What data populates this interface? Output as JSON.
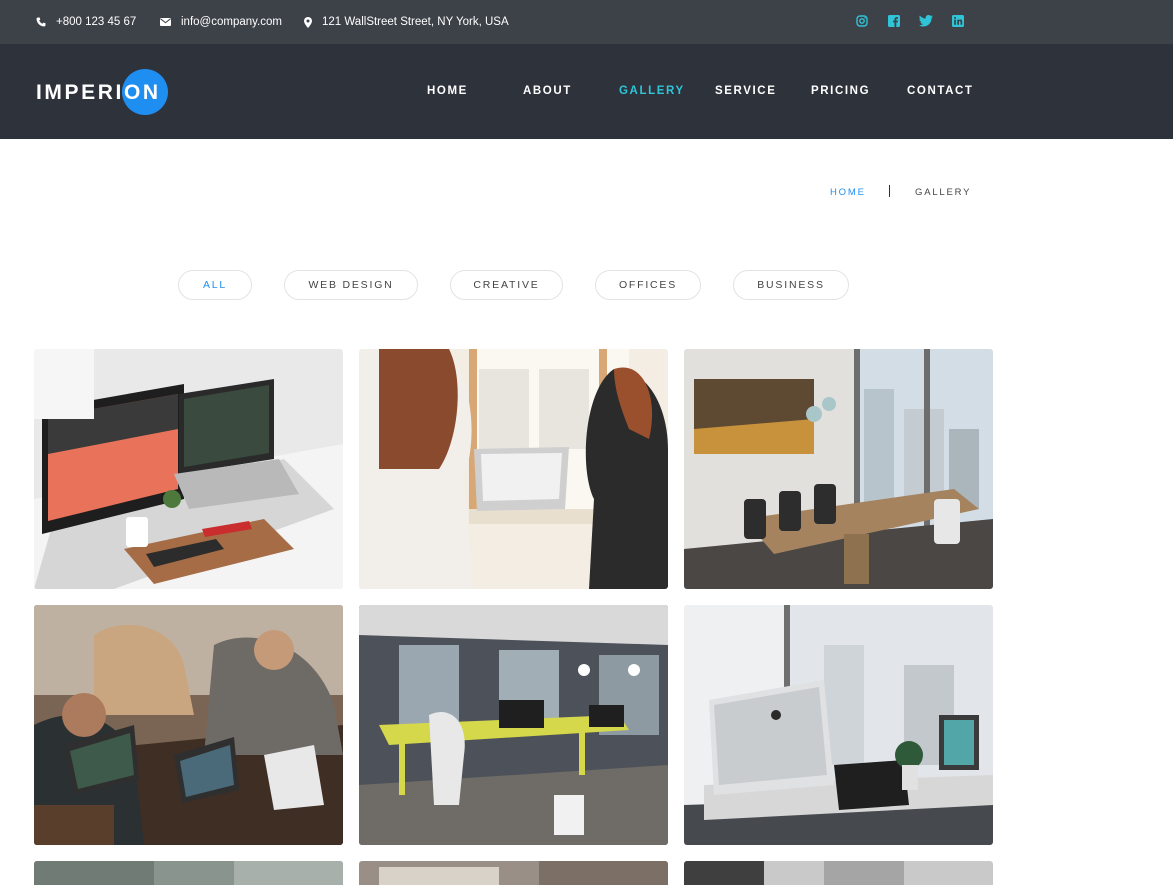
{
  "topbar": {
    "phone": "+800 123 45 67",
    "email": "info@company.com",
    "address": "121 WallStreet Street, NY York, USA",
    "social_icons": [
      "instagram-icon",
      "facebook-icon",
      "twitter-icon",
      "linkedin-icon"
    ]
  },
  "header": {
    "logo_text": "IMPERION",
    "nav": [
      {
        "label": "HOME",
        "active": false
      },
      {
        "label": "ABOUT",
        "active": false
      },
      {
        "label": "GALLERY",
        "active": true
      },
      {
        "label": "SERVICE",
        "active": false
      },
      {
        "label": "PRICING",
        "active": false
      },
      {
        "label": "CONTACT",
        "active": false
      }
    ]
  },
  "breadcrumb": {
    "home": "HOME",
    "current": "GALLERY"
  },
  "filters": [
    {
      "label": "ALL",
      "active": true
    },
    {
      "label": "WEB DESIGN",
      "active": false
    },
    {
      "label": "CREATIVE",
      "active": false
    },
    {
      "label": "OFFICES",
      "active": false
    },
    {
      "label": "BUSINESS",
      "active": false
    }
  ],
  "colors": {
    "topbar": "#3d4148",
    "header": "#2e323b",
    "accent_blue": "#1f8ef1",
    "accent_cyan": "#2fc4d8"
  }
}
